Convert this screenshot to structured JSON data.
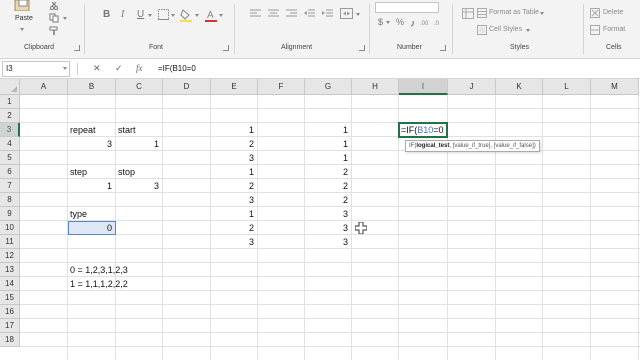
{
  "ribbon": {
    "clipboard": {
      "paste_label": "Paste",
      "group_label": "Clipboard"
    },
    "font": {
      "group_label": "Font",
      "bold": "B",
      "italic": "I",
      "underline": "U"
    },
    "alignment": {
      "group_label": "Alignment"
    },
    "number": {
      "group_label": "Number",
      "currency_symbol": "$",
      "percent_symbol": "%"
    },
    "styles": {
      "group_label": "Styles",
      "format_as_table": "Format as Table",
      "cell_styles": "Cell Styles"
    },
    "cells": {
      "group_label": "Cells",
      "delete_label": "Delete",
      "format_label": "Format"
    }
  },
  "formula_bar": {
    "name_box": "I3",
    "cancel_icon": "✕",
    "enter_icon": "✓",
    "function_icon": "fx",
    "formula": "=IF(B10=0"
  },
  "grid": {
    "columns": [
      "A",
      "B",
      "C",
      "D",
      "E",
      "F",
      "G",
      "H",
      "I",
      "J",
      "K",
      "L",
      "M"
    ],
    "active_column": "I",
    "rows": [
      "1",
      "2",
      "3",
      "4",
      "5",
      "6",
      "7",
      "8",
      "9",
      "10",
      "11",
      "12",
      "13",
      "14",
      "15",
      "16",
      "17",
      "18"
    ],
    "active_row": "3",
    "cells": [
      {
        "ref": "B3",
        "value": "repeat",
        "align": "left"
      },
      {
        "ref": "C3",
        "value": "start",
        "align": "left"
      },
      {
        "ref": "B4",
        "value": "3",
        "align": "right"
      },
      {
        "ref": "C4",
        "value": "1",
        "align": "right"
      },
      {
        "ref": "B6",
        "value": "step",
        "align": "left"
      },
      {
        "ref": "C6",
        "value": "stop",
        "align": "left"
      },
      {
        "ref": "B7",
        "value": "1",
        "align": "right"
      },
      {
        "ref": "C7",
        "value": "3",
        "align": "right"
      },
      {
        "ref": "B9",
        "value": "type",
        "align": "left"
      },
      {
        "ref": "B10",
        "value": "0",
        "align": "right"
      },
      {
        "ref": "E3",
        "value": "1",
        "align": "right"
      },
      {
        "ref": "E4",
        "value": "2",
        "align": "right"
      },
      {
        "ref": "E5",
        "value": "3",
        "align": "right"
      },
      {
        "ref": "E6",
        "value": "1",
        "align": "right"
      },
      {
        "ref": "E7",
        "value": "2",
        "align": "right"
      },
      {
        "ref": "E8",
        "value": "3",
        "align": "right"
      },
      {
        "ref": "E9",
        "value": "1",
        "align": "right"
      },
      {
        "ref": "E10",
        "value": "2",
        "align": "right"
      },
      {
        "ref": "E11",
        "value": "3",
        "align": "right"
      },
      {
        "ref": "G3",
        "value": "1",
        "align": "right"
      },
      {
        "ref": "G4",
        "value": "1",
        "align": "right"
      },
      {
        "ref": "G5",
        "value": "1",
        "align": "right"
      },
      {
        "ref": "G6",
        "value": "2",
        "align": "right"
      },
      {
        "ref": "G7",
        "value": "2",
        "align": "right"
      },
      {
        "ref": "G8",
        "value": "2",
        "align": "right"
      },
      {
        "ref": "G9",
        "value": "3",
        "align": "right"
      },
      {
        "ref": "G10",
        "value": "3",
        "align": "right"
      },
      {
        "ref": "G11",
        "value": "3",
        "align": "right"
      },
      {
        "ref": "B13",
        "value": "0 = 1,2,3,1,2,3",
        "align": "left"
      },
      {
        "ref": "B14",
        "value": "1 = 1,1,1,2,2,2",
        "align": "left"
      }
    ],
    "editing_cell": {
      "ref": "I3",
      "prefix": "=IF(",
      "reference": "B10",
      "suffix": "=0"
    },
    "tooltip": {
      "fn": "IF(",
      "arg_active": "logical_test",
      "rest": ", [value_if_true], [value_if_false])"
    }
  },
  "colors": {
    "accent_green": "#217346",
    "reference_blue": "#4472c4",
    "selection_fill": "#dde7f5"
  }
}
